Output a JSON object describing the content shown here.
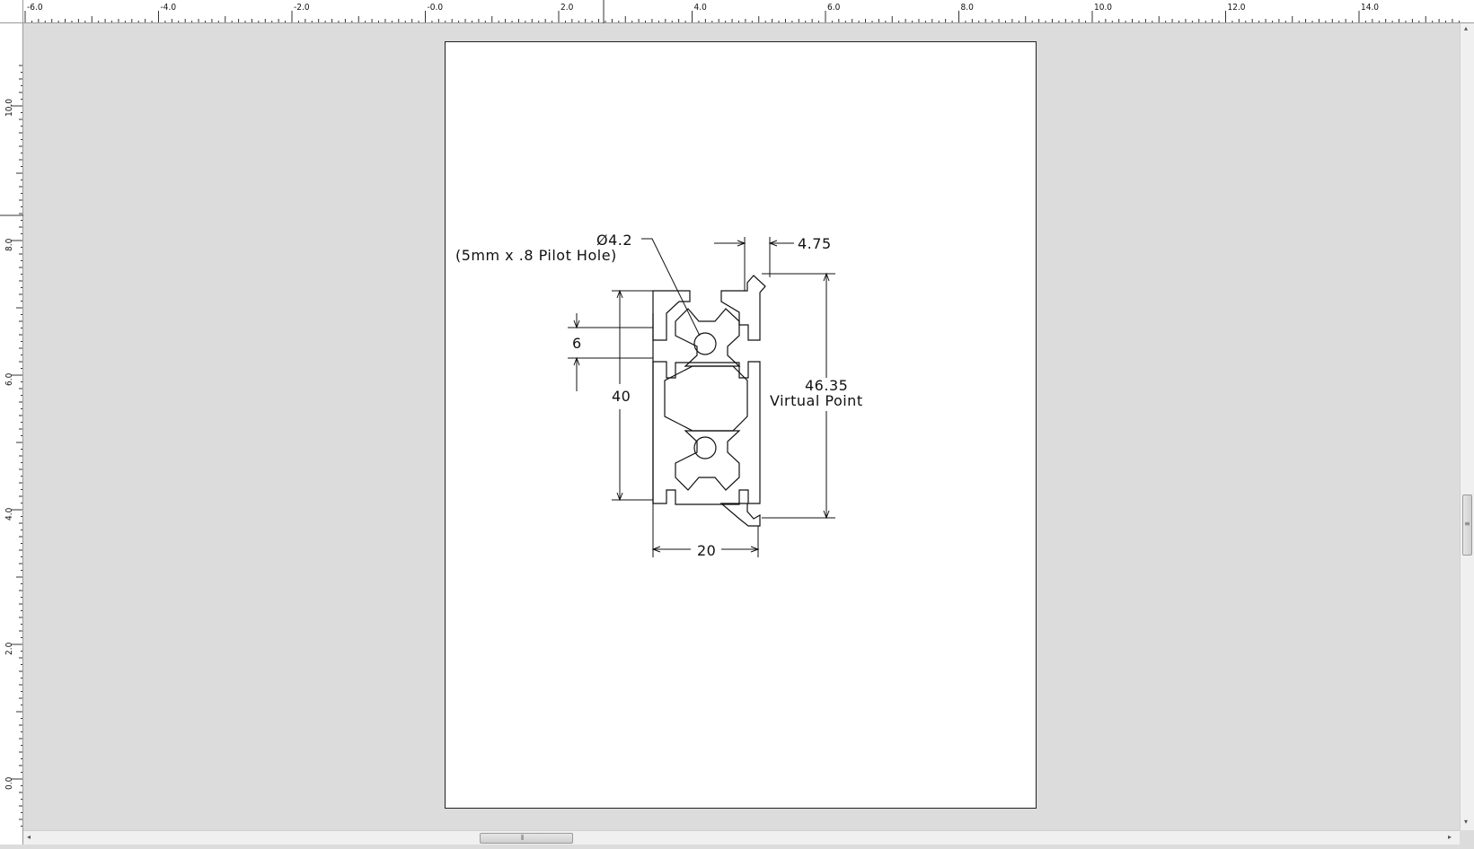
{
  "rulers": {
    "horizontal_labels": [
      "-6.0",
      "-4.0",
      "-2.0",
      "-0.0",
      "2.0",
      "4.0",
      "6.0",
      "8.0",
      "10.0",
      "12.0",
      "14.0"
    ],
    "vertical_labels": [
      "10.0",
      "8.0",
      "6.0",
      "4.0",
      "2.0",
      "0.0"
    ]
  },
  "drawing": {
    "hole_callout": "Ø4.2",
    "hole_note": "(5mm x .8 Pilot Hole)",
    "dim_top_right": "4.75",
    "dim_slot": "6",
    "dim_height": "40",
    "dim_width": "20",
    "dim_virtual_value": "46.35",
    "dim_virtual_label": "Virtual Point"
  },
  "scrollbars": {
    "vertical_grip": "≡",
    "horizontal_grip": "⦀",
    "left_arrow": "◂",
    "right_arrow": "▸",
    "up_arrow": "▴",
    "down_arrow": "▾"
  }
}
